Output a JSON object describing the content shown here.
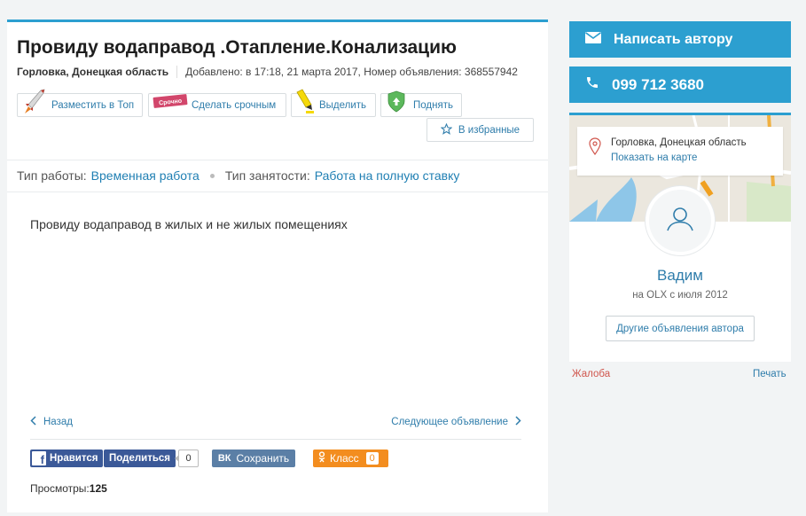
{
  "ad": {
    "title": "Провиду водаправод .Отапление.Конализацию",
    "location": "Горловка, Донецкая область",
    "added": "Добавлено: в 17:18, 21 марта 2017, Номер объявления: 368557942"
  },
  "promo": {
    "top": "Разместить в Топ",
    "urgent": "Сделать срочным",
    "urgent_tag": "Срочно",
    "highlight": "Выделить",
    "raise": "Поднять",
    "favorite": "В избранные"
  },
  "params": {
    "work_type_label": "Тип работы:",
    "work_type_value": "Временная работа",
    "employment_label": "Тип занятости:",
    "employment_value": "Работа на полную ставку"
  },
  "description": "Провиду водаправод в жилых и не жилых помещениях",
  "nav": {
    "back": "Назад",
    "next": "Следующее объявление"
  },
  "social": {
    "like": "Нравится",
    "share": "Поделиться",
    "share_count": "0",
    "vk_save": "Сохранить",
    "ok_label": "Класс",
    "ok_count": "0"
  },
  "views": {
    "label": "Просмотры:",
    "count": "125"
  },
  "sidebar": {
    "write_author": "Написать автору",
    "phone": "099 712 3680",
    "location": "Горловка, Донецкая область",
    "show_on_map": "Показать на карте",
    "user_name": "Вадим",
    "member_since": "на OLX с июля 2012",
    "other_ads": "Другие объявления автора",
    "complain": "Жалоба",
    "print": "Печать"
  },
  "colors": {
    "accent": "#2c9fd0",
    "link": "#2f7dab",
    "facebook": "#3b5998",
    "vk": "#5b7fa6",
    "ok": "#f38d1f",
    "complain": "#d0574e"
  }
}
